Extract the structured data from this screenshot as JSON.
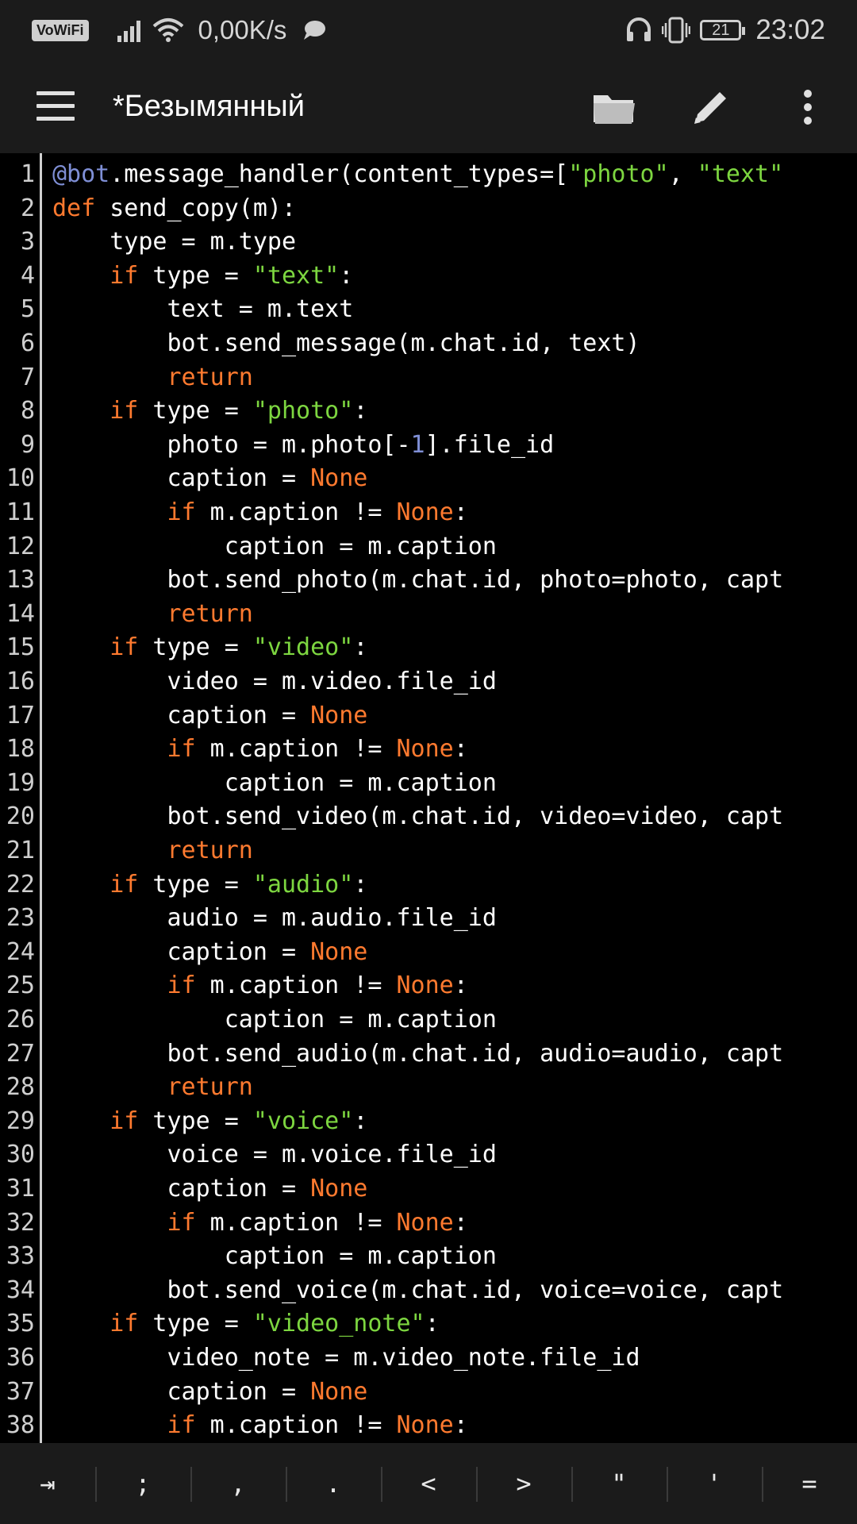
{
  "status_bar": {
    "vowifi": "VoWiFi",
    "speed": "0,00K/s",
    "battery": "21",
    "time": "23:02",
    "icons": [
      "signal-icon",
      "wifi-icon",
      "chat-bubble-icon",
      "headphones-icon",
      "vibrate-icon",
      "battery-icon"
    ]
  },
  "app_bar": {
    "title": "*Безымянный",
    "icons": [
      "menu-icon",
      "folder-icon",
      "edit-icon",
      "more-vert-icon"
    ]
  },
  "colors": {
    "keyword": "#ff7a2f",
    "string": "#7dd640",
    "decorator": "#7f8fd6",
    "text": "#ffffff",
    "background": "#000000",
    "bar": "#1b1b1b"
  },
  "editor": {
    "lines": [
      {
        "n": "1",
        "t": [
          {
            "c": "dec",
            "v": "@bot"
          },
          {
            "c": "",
            "v": ".message_handler(content_types=["
          },
          {
            "c": "str",
            "v": "\"photo\""
          },
          {
            "c": "",
            "v": ", "
          },
          {
            "c": "str",
            "v": "\"text\""
          }
        ]
      },
      {
        "n": "2",
        "t": [
          {
            "c": "kw",
            "v": "def"
          },
          {
            "c": "",
            "v": " send_copy(m):"
          }
        ]
      },
      {
        "n": "3",
        "t": [
          {
            "c": "",
            "v": "    type = m.type"
          }
        ]
      },
      {
        "n": "4",
        "t": [
          {
            "c": "",
            "v": "    "
          },
          {
            "c": "kw",
            "v": "if"
          },
          {
            "c": "",
            "v": " type = "
          },
          {
            "c": "str",
            "v": "\"text\""
          },
          {
            "c": "",
            "v": ":"
          }
        ]
      },
      {
        "n": "5",
        "t": [
          {
            "c": "",
            "v": "        text = m.text"
          }
        ]
      },
      {
        "n": "6",
        "t": [
          {
            "c": "",
            "v": "        bot.send_message(m.chat.id, text)"
          }
        ]
      },
      {
        "n": "7",
        "t": [
          {
            "c": "",
            "v": "        "
          },
          {
            "c": "kw",
            "v": "return"
          }
        ]
      },
      {
        "n": "8",
        "t": [
          {
            "c": "",
            "v": "    "
          },
          {
            "c": "kw",
            "v": "if"
          },
          {
            "c": "",
            "v": " type = "
          },
          {
            "c": "str",
            "v": "\"photo\""
          },
          {
            "c": "",
            "v": ":"
          }
        ]
      },
      {
        "n": "9",
        "t": [
          {
            "c": "",
            "v": "        photo = m.photo[-"
          },
          {
            "c": "num",
            "v": "1"
          },
          {
            "c": "",
            "v": "].file_id"
          }
        ]
      },
      {
        "n": "10",
        "t": [
          {
            "c": "",
            "v": "        caption = "
          },
          {
            "c": "kw",
            "v": "None"
          }
        ]
      },
      {
        "n": "11",
        "t": [
          {
            "c": "",
            "v": "        "
          },
          {
            "c": "kw",
            "v": "if"
          },
          {
            "c": "",
            "v": " m.caption != "
          },
          {
            "c": "kw",
            "v": "None"
          },
          {
            "c": "",
            "v": ":"
          }
        ]
      },
      {
        "n": "12",
        "t": [
          {
            "c": "",
            "v": "            caption = m.caption"
          }
        ]
      },
      {
        "n": "13",
        "t": [
          {
            "c": "",
            "v": "        bot.send_photo(m.chat.id, photo=photo, capt"
          }
        ]
      },
      {
        "n": "14",
        "t": [
          {
            "c": "",
            "v": "        "
          },
          {
            "c": "kw",
            "v": "return"
          }
        ]
      },
      {
        "n": "15",
        "t": [
          {
            "c": "",
            "v": "    "
          },
          {
            "c": "kw",
            "v": "if"
          },
          {
            "c": "",
            "v": " type = "
          },
          {
            "c": "str",
            "v": "\"video\""
          },
          {
            "c": "",
            "v": ":"
          }
        ]
      },
      {
        "n": "16",
        "t": [
          {
            "c": "",
            "v": "        video = m.video.file_id"
          }
        ]
      },
      {
        "n": "17",
        "t": [
          {
            "c": "",
            "v": "        caption = "
          },
          {
            "c": "kw",
            "v": "None"
          }
        ]
      },
      {
        "n": "18",
        "t": [
          {
            "c": "",
            "v": "        "
          },
          {
            "c": "kw",
            "v": "if"
          },
          {
            "c": "",
            "v": " m.caption != "
          },
          {
            "c": "kw",
            "v": "None"
          },
          {
            "c": "",
            "v": ":"
          }
        ]
      },
      {
        "n": "19",
        "t": [
          {
            "c": "",
            "v": "            caption = m.caption"
          }
        ]
      },
      {
        "n": "20",
        "t": [
          {
            "c": "",
            "v": "        bot.send_video(m.chat.id, video=video, capt"
          }
        ]
      },
      {
        "n": "21",
        "t": [
          {
            "c": "",
            "v": "        "
          },
          {
            "c": "kw",
            "v": "return"
          }
        ]
      },
      {
        "n": "22",
        "t": [
          {
            "c": "",
            "v": "    "
          },
          {
            "c": "kw",
            "v": "if"
          },
          {
            "c": "",
            "v": " type = "
          },
          {
            "c": "str",
            "v": "\"audio\""
          },
          {
            "c": "",
            "v": ":"
          }
        ]
      },
      {
        "n": "23",
        "t": [
          {
            "c": "",
            "v": "        audio = m.audio.file_id"
          }
        ]
      },
      {
        "n": "24",
        "t": [
          {
            "c": "",
            "v": "        caption = "
          },
          {
            "c": "kw",
            "v": "None"
          }
        ]
      },
      {
        "n": "25",
        "t": [
          {
            "c": "",
            "v": "        "
          },
          {
            "c": "kw",
            "v": "if"
          },
          {
            "c": "",
            "v": " m.caption != "
          },
          {
            "c": "kw",
            "v": "None"
          },
          {
            "c": "",
            "v": ":"
          }
        ]
      },
      {
        "n": "26",
        "t": [
          {
            "c": "",
            "v": "            caption = m.caption"
          }
        ]
      },
      {
        "n": "27",
        "t": [
          {
            "c": "",
            "v": "        bot.send_audio(m.chat.id, audio=audio, capt"
          }
        ]
      },
      {
        "n": "28",
        "t": [
          {
            "c": "",
            "v": "        "
          },
          {
            "c": "kw",
            "v": "return"
          }
        ]
      },
      {
        "n": "29",
        "t": [
          {
            "c": "",
            "v": "    "
          },
          {
            "c": "kw",
            "v": "if"
          },
          {
            "c": "",
            "v": " type = "
          },
          {
            "c": "str",
            "v": "\"voice\""
          },
          {
            "c": "",
            "v": ":"
          }
        ]
      },
      {
        "n": "30",
        "t": [
          {
            "c": "",
            "v": "        voice = m.voice.file_id"
          }
        ]
      },
      {
        "n": "31",
        "t": [
          {
            "c": "",
            "v": "        caption = "
          },
          {
            "c": "kw",
            "v": "None"
          }
        ]
      },
      {
        "n": "32",
        "t": [
          {
            "c": "",
            "v": "        "
          },
          {
            "c": "kw",
            "v": "if"
          },
          {
            "c": "",
            "v": " m.caption != "
          },
          {
            "c": "kw",
            "v": "None"
          },
          {
            "c": "",
            "v": ":"
          }
        ]
      },
      {
        "n": "33",
        "t": [
          {
            "c": "",
            "v": "            caption = m.caption"
          }
        ]
      },
      {
        "n": "34",
        "t": [
          {
            "c": "",
            "v": "        bot.send_voice(m.chat.id, voice=voice, capt"
          }
        ]
      },
      {
        "n": "35",
        "t": [
          {
            "c": "",
            "v": "    "
          },
          {
            "c": "kw",
            "v": "if"
          },
          {
            "c": "",
            "v": " type = "
          },
          {
            "c": "str",
            "v": "\"video_note\""
          },
          {
            "c": "",
            "v": ":"
          }
        ]
      },
      {
        "n": "36",
        "t": [
          {
            "c": "",
            "v": "        video_note = m.video_note.file_id"
          }
        ]
      },
      {
        "n": "37",
        "t": [
          {
            "c": "",
            "v": "        caption = "
          },
          {
            "c": "kw",
            "v": "None"
          }
        ]
      },
      {
        "n": "38",
        "t": [
          {
            "c": "",
            "v": "        "
          },
          {
            "c": "kw",
            "v": "if"
          },
          {
            "c": "",
            "v": " m.caption != "
          },
          {
            "c": "kw",
            "v": "None"
          },
          {
            "c": "",
            "v": ":"
          }
        ]
      }
    ]
  },
  "symbol_bar": {
    "keys": [
      "⇥",
      ";",
      ",",
      ".",
      "<",
      ">",
      "\"",
      "'",
      "="
    ]
  }
}
